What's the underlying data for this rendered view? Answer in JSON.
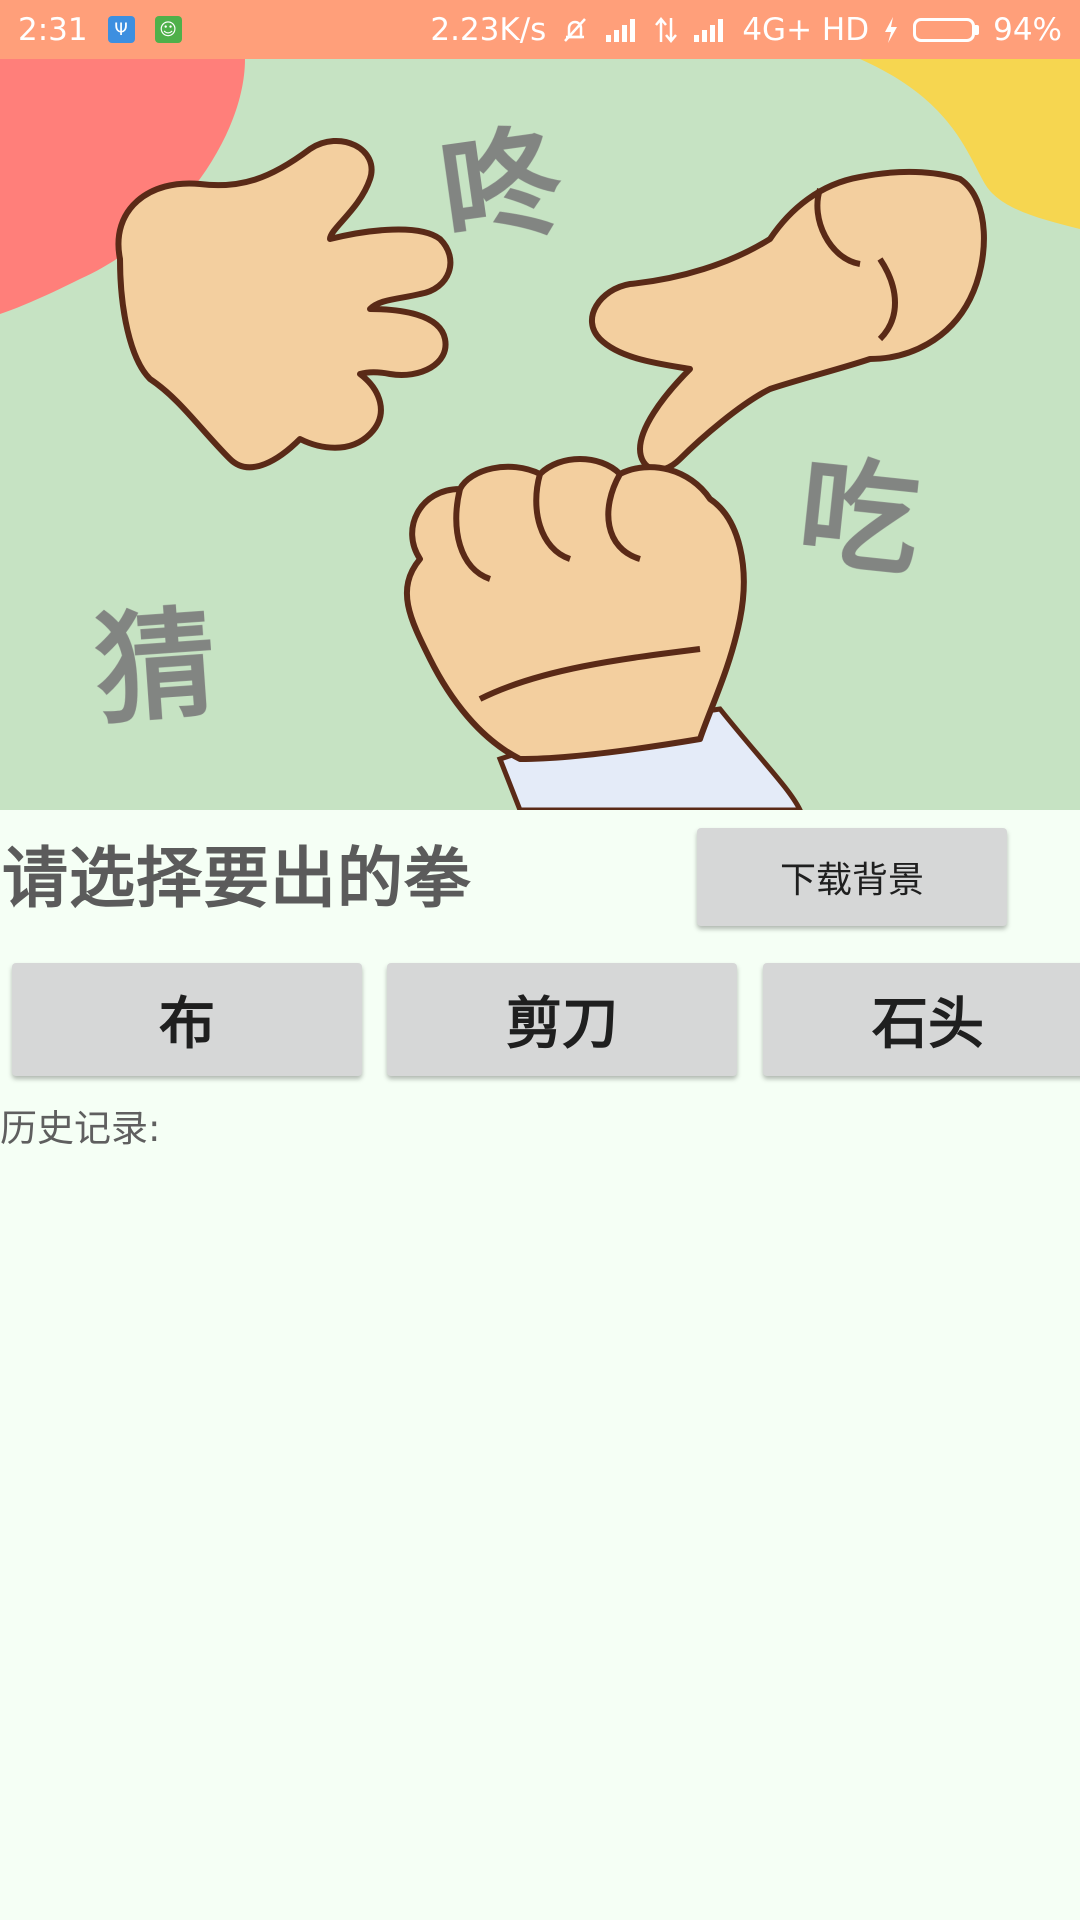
{
  "status_bar": {
    "time": "2:31",
    "network_speed": "2.23K/s",
    "network_type": "4G+ HD",
    "battery_level": 94,
    "battery_text": "94%",
    "icons": [
      "usb-icon",
      "android-icon",
      "mute-icon",
      "signal-icon",
      "data-arrows-icon",
      "signal-icon",
      "charging-icon",
      "battery-icon"
    ],
    "background_color": "#ff9f7a"
  },
  "hero": {
    "chars": [
      "咚",
      "吃",
      "猜"
    ]
  },
  "main": {
    "prompt": "请选择要出的拳",
    "download_button": "下载背景",
    "choices": [
      "布",
      "剪刀",
      "石头"
    ],
    "history_label": "历史记录:"
  },
  "colors": {
    "background": "#f5fff5",
    "button": "#d6d7d7",
    "prompt_text": "#5b5b5b"
  }
}
